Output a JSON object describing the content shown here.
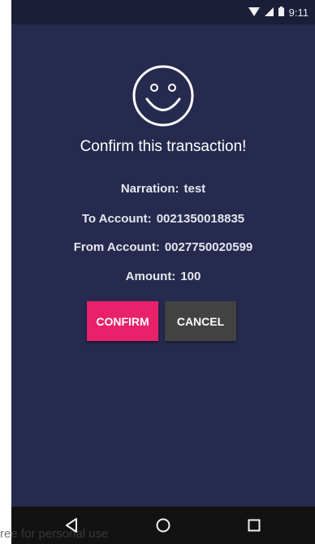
{
  "status_bar": {
    "time": "9:11",
    "icons": [
      "wifi-icon",
      "cell-signal-icon",
      "battery-icon"
    ]
  },
  "dialog": {
    "icon": "smiley-icon",
    "title": "Confirm this transaction!",
    "details": [
      {
        "label": "Narration:",
        "value": "test"
      },
      {
        "label": "To Account:",
        "value": "0021350018835"
      },
      {
        "label": "From Account:",
        "value": "0027750020599"
      },
      {
        "label": "Amount:",
        "value": "100"
      }
    ],
    "confirm_label": "CONFIRM",
    "cancel_label": "CANCEL"
  },
  "nav_bar": {
    "icons": [
      "back-icon",
      "home-icon",
      "recents-icon"
    ]
  },
  "watermark": "ree for personal use",
  "colors": {
    "background": "#262a4e",
    "confirm": "#e8216a",
    "cancel": "#424242",
    "text": "#ffffff"
  }
}
